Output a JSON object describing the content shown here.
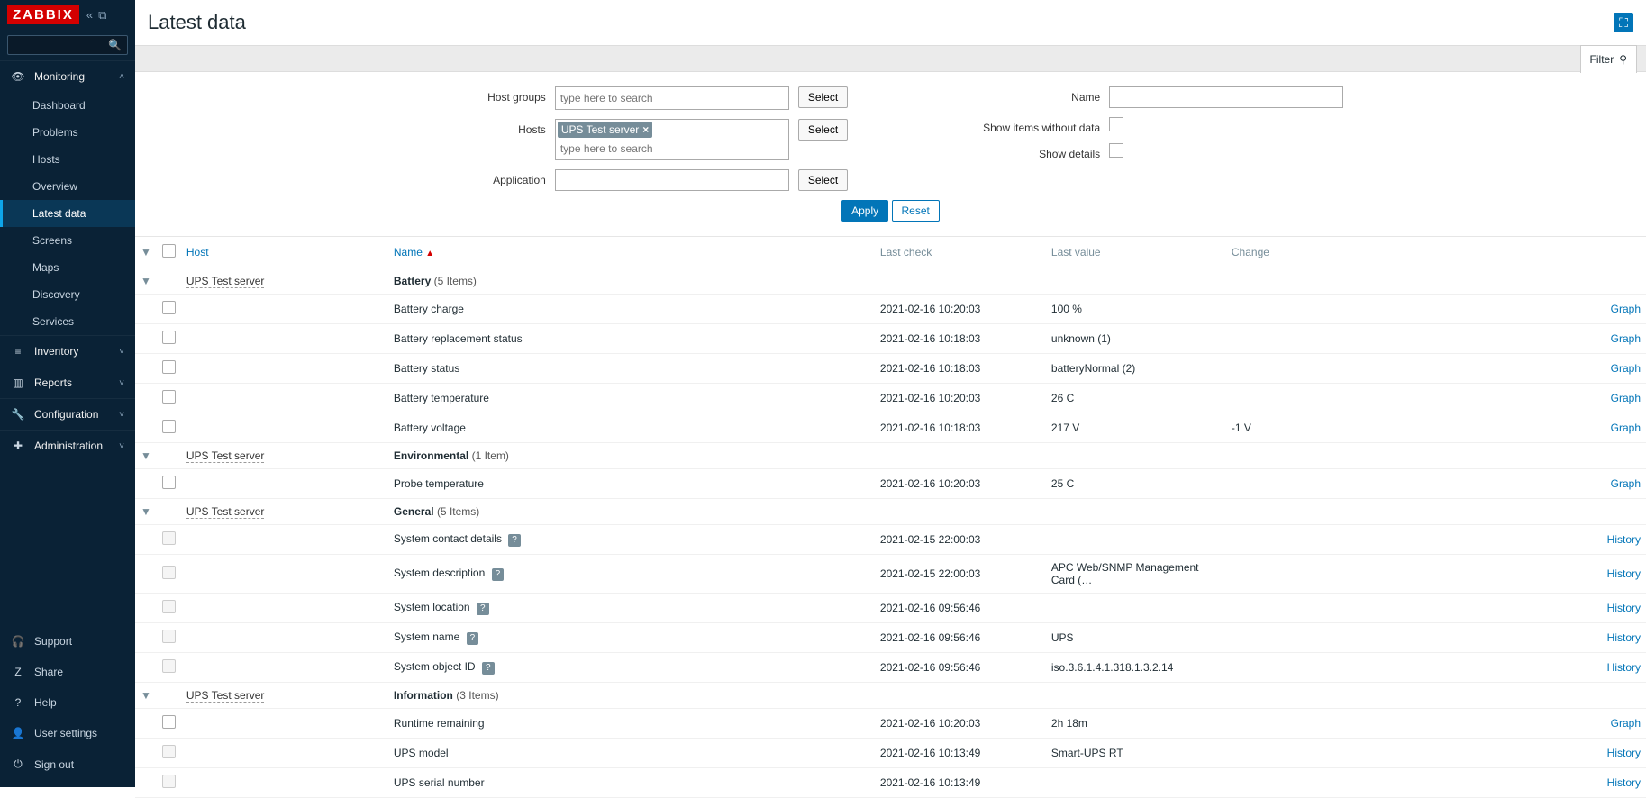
{
  "brand": "ZABBIX",
  "search": {
    "placeholder": ""
  },
  "nav": {
    "monitoring": {
      "label": "Monitoring",
      "items": {
        "dashboard": "Dashboard",
        "problems": "Problems",
        "hosts": "Hosts",
        "overview": "Overview",
        "latest": "Latest data",
        "screens": "Screens",
        "maps": "Maps",
        "discovery": "Discovery",
        "services": "Services"
      }
    },
    "inventory": "Inventory",
    "reports": "Reports",
    "configuration": "Configuration",
    "administration": "Administration",
    "bottom": {
      "support": "Support",
      "share": "Share",
      "help": "Help",
      "user": "User settings",
      "signout": "Sign out"
    }
  },
  "page_title": "Latest data",
  "filter_tab": "Filter",
  "filter": {
    "host_groups_label": "Host groups",
    "hosts_label": "Hosts",
    "application_label": "Application",
    "name_label": "Name",
    "without_data_label": "Show items without data",
    "details_label": "Show details",
    "placeholder": "type here to search",
    "select": "Select",
    "apply": "Apply",
    "reset": "Reset",
    "host_tag": "UPS Test server"
  },
  "table": {
    "headers": {
      "host": "Host",
      "name": "Name",
      "last_check": "Last check",
      "last_value": "Last value",
      "change": "Change"
    },
    "groups": [
      {
        "host": "UPS Test server",
        "app": "Battery",
        "count": "(5 Items)",
        "rows": [
          {
            "name": "Battery charge",
            "check": "2021-02-16 10:20:03",
            "value": "100 %",
            "change": "",
            "action": "Graph"
          },
          {
            "name": "Battery replacement status",
            "check": "2021-02-16 10:18:03",
            "value": "unknown (1)",
            "change": "",
            "action": "Graph"
          },
          {
            "name": "Battery status",
            "check": "2021-02-16 10:18:03",
            "value": "batteryNormal (2)",
            "change": "",
            "action": "Graph"
          },
          {
            "name": "Battery temperature",
            "check": "2021-02-16 10:20:03",
            "value": "26 C",
            "change": "",
            "action": "Graph"
          },
          {
            "name": "Battery voltage",
            "check": "2021-02-16 10:18:03",
            "value": "217 V",
            "change": "-1 V",
            "action": "Graph"
          }
        ]
      },
      {
        "host": "UPS Test server",
        "app": "Environmental",
        "count": "(1 Item)",
        "rows": [
          {
            "name": "Probe temperature",
            "check": "2021-02-16 10:20:03",
            "value": "25 C",
            "change": "",
            "action": "Graph"
          }
        ]
      },
      {
        "host": "UPS Test server",
        "app": "General",
        "count": "(5 Items)",
        "rows": [
          {
            "name": "System contact details",
            "badge": true,
            "check": "2021-02-15 22:00:03",
            "value": "",
            "change": "",
            "action": "History",
            "grey": true
          },
          {
            "name": "System description",
            "badge": true,
            "check": "2021-02-15 22:00:03",
            "value": "APC Web/SNMP Management Card (…",
            "change": "",
            "action": "History",
            "grey": true
          },
          {
            "name": "System location",
            "badge": true,
            "check": "2021-02-16 09:56:46",
            "value": "",
            "change": "",
            "action": "History",
            "grey": true
          },
          {
            "name": "System name",
            "badge": true,
            "check": "2021-02-16 09:56:46",
            "value": "UPS",
            "change": "",
            "action": "History",
            "grey": true
          },
          {
            "name": "System object ID",
            "badge": true,
            "check": "2021-02-16 09:56:46",
            "value": "iso.3.6.1.4.1.318.1.3.2.14",
            "change": "",
            "action": "History",
            "grey": true
          }
        ]
      },
      {
        "host": "UPS Test server",
        "app": "Information",
        "count": "(3 Items)",
        "rows": [
          {
            "name": "Runtime remaining",
            "check": "2021-02-16 10:20:03",
            "value": "2h 18m",
            "change": "",
            "action": "Graph"
          },
          {
            "name": "UPS model",
            "check": "2021-02-16 10:13:49",
            "value": "Smart-UPS RT",
            "change": "",
            "action": "History",
            "grey": true
          },
          {
            "name": "UPS serial number",
            "check": "2021-02-16 10:13:49",
            "value": "",
            "change": "",
            "action": "History",
            "grey": true
          }
        ]
      }
    ]
  }
}
